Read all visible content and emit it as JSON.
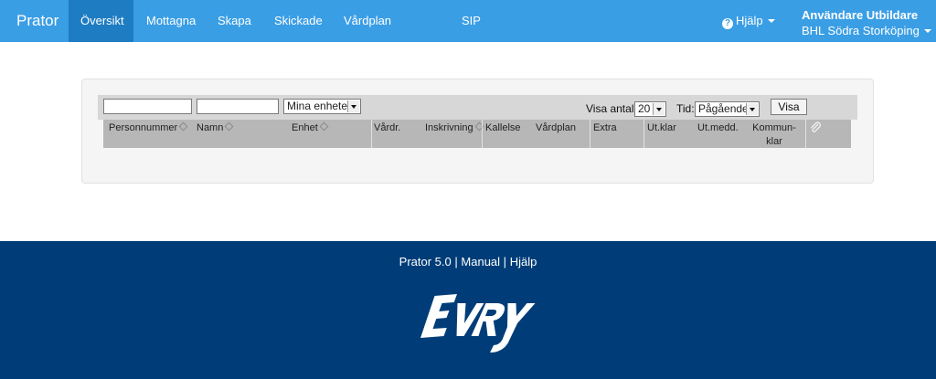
{
  "navbar": {
    "brand": "Prator",
    "items": [
      {
        "label": "Översikt",
        "active": true
      },
      {
        "label": "Mottagna",
        "active": false
      },
      {
        "label": "Skapa",
        "active": false
      },
      {
        "label": "Skickade",
        "active": false
      },
      {
        "label": "Vårdplan",
        "active": false
      },
      {
        "label": "SIP",
        "active": false
      }
    ],
    "help_label": "Hjälp",
    "user_name": "Användare Utbildare",
    "user_unit": "BHL Södra Storköping"
  },
  "filters": {
    "personnummer_value": "",
    "namn_value": "",
    "unit_select": "Mina enheter",
    "visa_antal_label": "Visa antal:",
    "visa_antal_value": "20",
    "tid_label": "Tid:",
    "tid_value": "Pågående",
    "visa_button": "Visa"
  },
  "table": {
    "columns": [
      {
        "label": "Personnummer",
        "sortable": true
      },
      {
        "label": "Namn",
        "sortable": true
      },
      {
        "label": "Enhet",
        "sortable": true
      },
      {
        "label": "Vårdr.",
        "sortable": false
      },
      {
        "label": "Inskrivning",
        "sortable": true
      },
      {
        "label": "Kallelse",
        "sortable": false
      },
      {
        "label": "Vårdplan",
        "sortable": false
      },
      {
        "label": "Extra",
        "sortable": false
      },
      {
        "label": "Ut.klar",
        "sortable": false
      },
      {
        "label": "Ut.medd.",
        "sortable": false
      },
      {
        "label": "Kommun-",
        "label2": "klar",
        "sortable": false
      }
    ],
    "attachment_icon": "paperclip-icon"
  },
  "footer": {
    "version": "Prator 5.0",
    "separator": "|",
    "manual": "Manual",
    "help": "Hjälp",
    "logo_text": "EVRY"
  },
  "colors": {
    "navbar": "#3a9ee5",
    "navbar_active": "#1e7cc2",
    "footer": "#003d78"
  }
}
